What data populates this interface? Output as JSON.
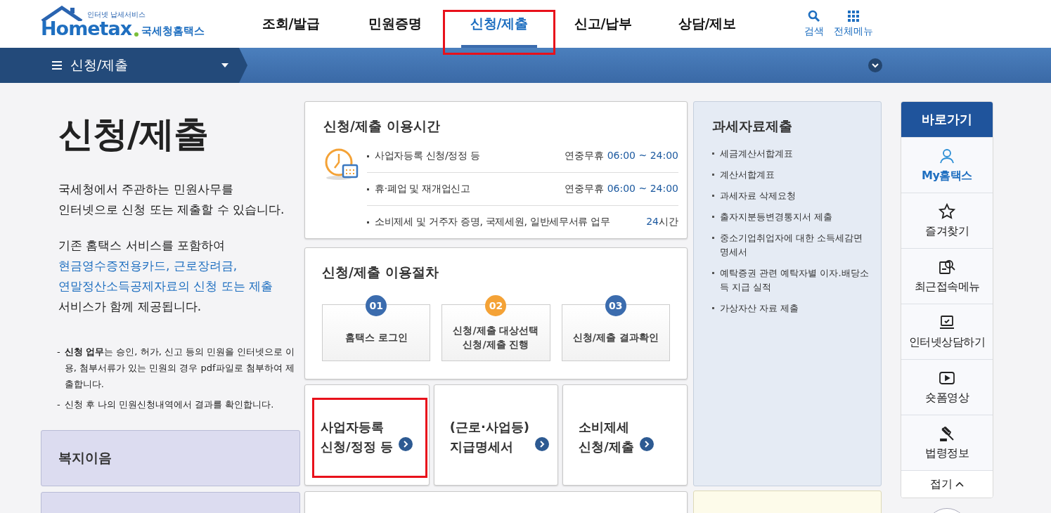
{
  "header": {
    "logo": {
      "tagline": "인터넷 납세서비스",
      "wordmark": "Hometax",
      "name": "국세청홈택스"
    },
    "nav": [
      {
        "label": "조회/발급",
        "selected": false,
        "highlighted": false
      },
      {
        "label": "민원증명",
        "selected": false,
        "highlighted": false
      },
      {
        "label": "신청/제출",
        "selected": true,
        "highlighted": true
      },
      {
        "label": "신고/납부",
        "selected": false,
        "highlighted": false
      },
      {
        "label": "상담/제보",
        "selected": false,
        "highlighted": false
      }
    ],
    "tools": [
      {
        "kind": "search",
        "label": "검색"
      },
      {
        "kind": "menu",
        "label": "전체메뉴"
      }
    ]
  },
  "subnav": {
    "label": "신청/제출"
  },
  "intro": {
    "title": "신청/제출",
    "paragraph_1": "국세청에서 주관하는 민원사무를\n인터넷으로 신청 또는 제출할 수 있습니다.",
    "paragraph_2": {
      "before": "기존 홈택스 서비스를 포함하여",
      "highlight": "현금영수증전용카드, 근로장려금,\n연말정산소득공제자료의 신청 또는 제출",
      "after": "서비스가 함께 제공됩니다."
    },
    "notes": [
      {
        "marker": "-",
        "text": "**신청 업무**는 승인, 허가, 신고 등의 민원을 인터넷으로 이용, 첨부서류가 있는 민원의 경우 pdf파일로 첨부하여 제출합니다."
      },
      {
        "marker": "-",
        "text": "신청 후 나의 민원신청내역에서 결과를 확인합니다."
      }
    ]
  },
  "welfare_card": {
    "title": "복지이음"
  },
  "hours": {
    "title": "신청/제출 이용시간",
    "rows": [
      {
        "kind": "daily",
        "label": "사업자등록 신청/정정 등",
        "prefix": "연중무휴",
        "time": "06:00 ~ 24:00"
      },
      {
        "kind": "daily",
        "label": "휴·폐업 및 재개업신고",
        "prefix": "연중무휴",
        "time": "06:00 ~ 24:00"
      },
      {
        "kind": "allday",
        "label": "소비제세 및 거주자 증명, 국제세원, 일반세무서류 업무",
        "time": "24",
        "suffix": "시간"
      }
    ]
  },
  "procedure": {
    "title": "신청/제출 이용절차",
    "steps": [
      {
        "number": "01",
        "label": "홈택스 로그인",
        "color": "#3b6cae"
      },
      {
        "number": "02",
        "label": "신청/제출 대상선택\n신청/제출 진행",
        "color": "#f4a236"
      },
      {
        "number": "03",
        "label": "신청/제출 결과확인",
        "color": "#3b6cae"
      }
    ]
  },
  "shortcuts": [
    {
      "label": "사업자등록\n신청/정정 등",
      "highlighted": true
    },
    {
      "label": "(근로·사업등)\n지급명세서",
      "highlighted": false
    },
    {
      "label": "소비제세\n신청/제출",
      "highlighted": false
    }
  ],
  "tax_data": {
    "title": "과세자료제출",
    "items": [
      "세금계산서합계표",
      "계산서합계표",
      "과세자료 삭제요청",
      "출자지분등변경통지서 제출",
      "중소기업취업자에 대한 소득세감면명세서",
      "예탁증권 관련 예탁자별 이자.배당소득 지급 실적",
      "가상자산 자료 제출"
    ]
  },
  "quick_links": {
    "title": "바로가기",
    "items": [
      {
        "kind": "user",
        "label": "My홈택스",
        "selected": true
      },
      {
        "kind": "star",
        "label": "즐겨찾기",
        "selected": false
      },
      {
        "kind": "recent",
        "label": "최근접속메뉴",
        "selected": false
      },
      {
        "kind": "consult",
        "label": "인터넷상담하기",
        "selected": false
      },
      {
        "kind": "video",
        "label": "숏폼영상",
        "selected": false
      },
      {
        "kind": "law",
        "label": "법령정보",
        "selected": false
      }
    ],
    "collapse": "접기"
  }
}
